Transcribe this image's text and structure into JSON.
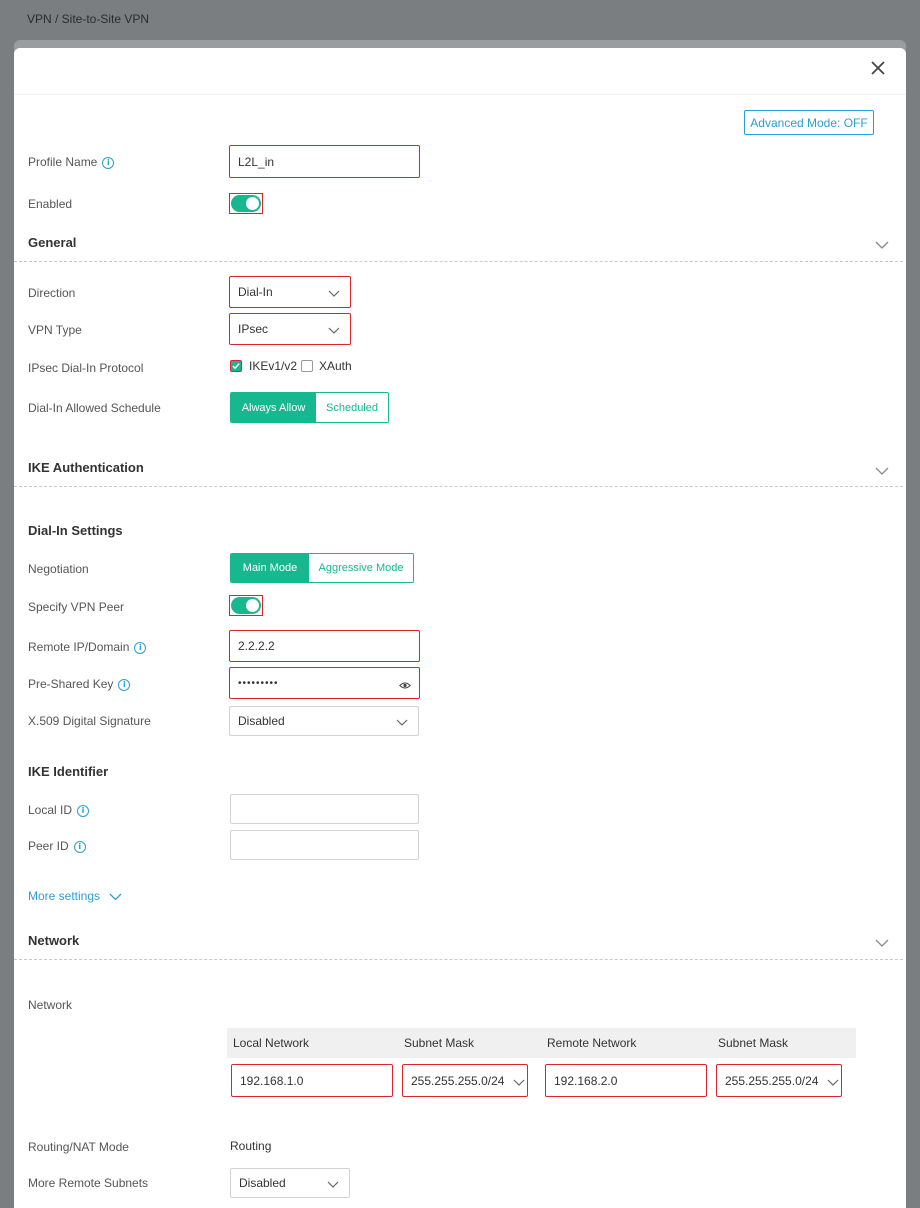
{
  "breadcrumb": "VPN / Site-to-Site VPN",
  "advanced_mode_label": "Advanced Mode: OFF",
  "profile": {
    "name_label": "Profile Name",
    "name_value": "L2L_in",
    "enabled_label": "Enabled",
    "enabled": true
  },
  "general": {
    "title": "General",
    "direction_label": "Direction",
    "direction_value": "Dial-In",
    "vpn_type_label": "VPN Type",
    "vpn_type_value": "IPsec",
    "protocol_label": "IPsec Dial-In Protocol",
    "protocol_options": [
      {
        "label": "IKEv1/v2",
        "checked": true
      },
      {
        "label": "XAuth",
        "checked": false
      }
    ],
    "schedule_label": "Dial-In Allowed Schedule",
    "schedule_options": [
      "Always Allow",
      "Scheduled"
    ],
    "schedule_selected": "Always Allow"
  },
  "ike": {
    "title": "IKE Authentication",
    "dialin_title": "Dial-In Settings",
    "negotiation_label": "Negotiation",
    "negotiation_options": [
      "Main Mode",
      "Aggressive Mode"
    ],
    "negotiation_selected": "Main Mode",
    "peer_label": "Specify VPN Peer",
    "peer_enabled": true,
    "remote_label": "Remote IP/Domain",
    "remote_value": "2.2.2.2",
    "psk_label": "Pre-Shared Key",
    "psk_value": "•••••••••",
    "x509_label": "X.509 Digital Signature",
    "x509_value": "Disabled",
    "identifier_title": "IKE Identifier",
    "local_id_label": "Local ID",
    "local_id_value": "",
    "peer_id_label": "Peer ID",
    "peer_id_value": "",
    "more_settings": "More settings"
  },
  "network": {
    "title": "Network",
    "network_label": "Network",
    "columns": [
      "Local Network",
      "Subnet Mask",
      "Remote Network",
      "Subnet Mask"
    ],
    "row": {
      "local_network": "192.168.1.0",
      "local_mask": "255.255.255.0/24",
      "remote_network": "192.168.2.0",
      "remote_mask": "255.255.255.0/24"
    },
    "routing_label": "Routing/NAT Mode",
    "routing_value": "Routing",
    "more_subnets_label": "More Remote Subnets",
    "more_subnets_value": "Disabled"
  },
  "colors": {
    "accent": "#17b890",
    "link": "#2a9fd6",
    "highlight": "#d9262b"
  }
}
